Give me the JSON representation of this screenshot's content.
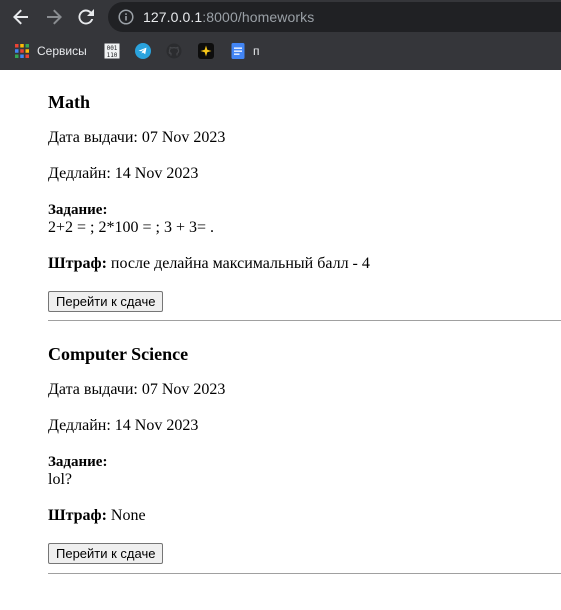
{
  "browser": {
    "url_host": "127.0.0.1",
    "url_rest": ":8000/homeworks",
    "back_icon": "arrow-back-icon",
    "forward_icon": "arrow-forward-icon",
    "reload_icon": "reload-icon",
    "info_icon": "info-icon"
  },
  "bookmarks": [
    {
      "label": "Сервисы",
      "icon": "apps-grid-icon"
    },
    {
      "label": "",
      "icon": "binary-icon"
    },
    {
      "label": "",
      "icon": "telegram-icon"
    },
    {
      "label": "",
      "icon": "github-icon"
    },
    {
      "label": "",
      "icon": "sparkle-icon"
    },
    {
      "label": "п",
      "icon": "docs-icon"
    }
  ],
  "homeworks": [
    {
      "title": "Math",
      "issued_label": "Дата выдачи:",
      "issued_date": "07 Nov 2023",
      "deadline_label": "Дедлайн:",
      "deadline_date": "14 Nov 2023",
      "task_label": "Задание:",
      "task_text": "2+2 = ; 2*100 = ; 3 + 3= .",
      "penalty_label": "Штраф:",
      "penalty_text": "после делайна максимальный балл - 4",
      "button_label": "Перейти к сдаче"
    },
    {
      "title": "Computer Science",
      "issued_label": "Дата выдачи:",
      "issued_date": "07 Nov 2023",
      "deadline_label": "Дедлайн:",
      "deadline_date": "14 Nov 2023",
      "task_label": "Задание:",
      "task_text": "lol?",
      "penalty_label": "Штраф:",
      "penalty_text": "None",
      "button_label": "Перейти к сдаче"
    }
  ]
}
